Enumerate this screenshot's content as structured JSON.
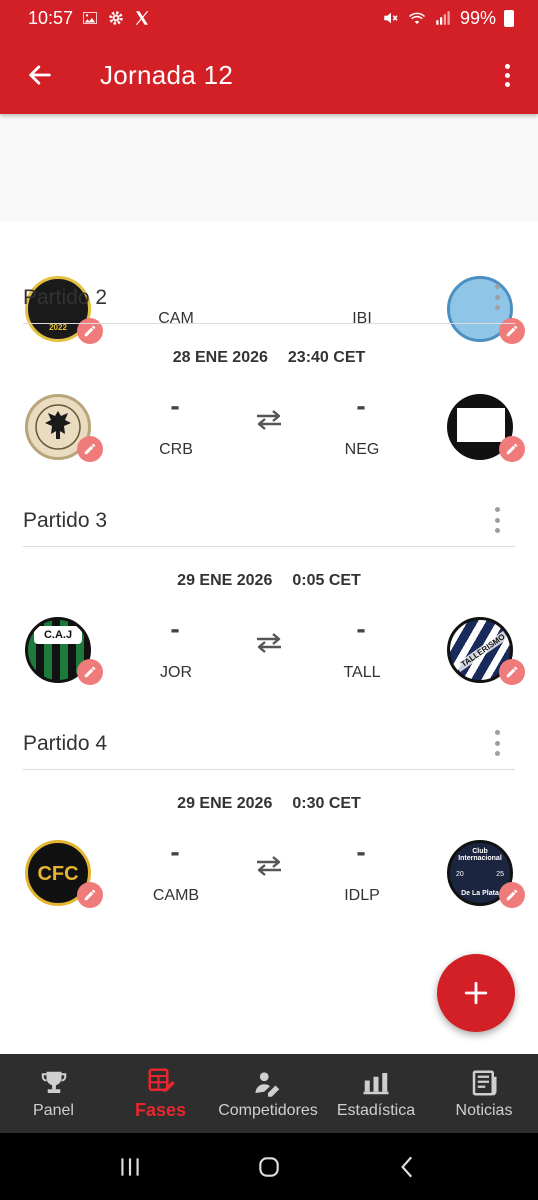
{
  "status_bar": {
    "time": "10:57",
    "battery": "99%"
  },
  "app_bar": {
    "title": "Jornada 12"
  },
  "partial_match": {
    "home_abbr": "CAM",
    "away_abbr": "IBI"
  },
  "matches": [
    {
      "title": "Partido 2",
      "date": "28 ENE 2026",
      "time": "23:40 CET",
      "home_score": "-",
      "away_score": "-",
      "home_abbr": "CRB",
      "away_abbr": "NEG"
    },
    {
      "title": "Partido 3",
      "date": "29 ENE 2026",
      "time": "0:05 CET",
      "home_score": "-",
      "away_score": "-",
      "home_abbr": "JOR",
      "away_abbr": "TALL"
    },
    {
      "title": "Partido 4",
      "date": "29 ENE 2026",
      "time": "0:30 CET",
      "home_score": "-",
      "away_score": "-",
      "home_abbr": "CAMB",
      "away_abbr": "IDLP"
    }
  ],
  "crest_text": {
    "cam_year": "2022",
    "cai": "C.A.J",
    "tall": "TALLERISMO",
    "cfc": "CFC",
    "idlp_top": "Club Internacional",
    "idlp_bottom": "De La Plata",
    "idlp_left": "20",
    "idlp_right": "25"
  },
  "fab": {
    "icon": "plus-icon"
  },
  "bottom_nav": [
    {
      "label": "Panel",
      "icon": "trophy-icon",
      "active": false
    },
    {
      "label": "Fases",
      "icon": "bracket-icon",
      "active": true
    },
    {
      "label": "Competidores",
      "icon": "person-icon",
      "active": false
    },
    {
      "label": "Estadística",
      "icon": "bar-chart-icon",
      "active": false
    },
    {
      "label": "Noticias",
      "icon": "newspaper-icon",
      "active": false
    }
  ],
  "colors": {
    "primary": "#d32027",
    "active_nav": "#e8262d",
    "edit_badge": "#f07b7b",
    "nav_background": "#2e2e2e"
  }
}
